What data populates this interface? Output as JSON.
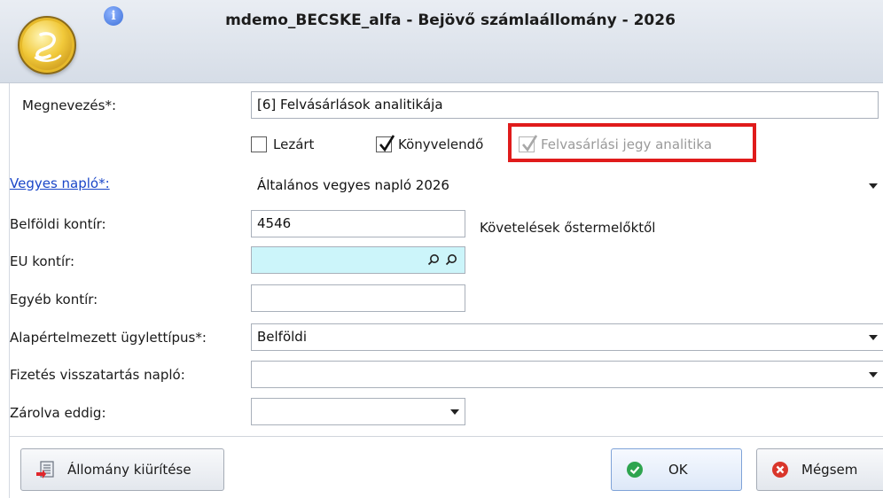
{
  "window": {
    "title": "mdemo_BECSKE_alfa - Bejövő számlaállomány - 2026"
  },
  "form": {
    "megnevezes": {
      "label": "Megnevezés*:",
      "value": "[6] Felvásárlások analitikája"
    },
    "checkboxes": {
      "lezart": {
        "label": "Lezárt",
        "checked": false
      },
      "konyvelendo": {
        "label": "Könyvelendő",
        "checked": true
      },
      "felvasarlasi": {
        "label": "Felvasárlási jegy analitika",
        "checked": true,
        "disabled": true
      }
    },
    "vegyes_naplo": {
      "label": "Vegyes napló*:",
      "value": "Általános vegyes napló 2026"
    },
    "belfoldi_kontir": {
      "label": "Belföldi kontír:",
      "value": "4546",
      "description": "Követelések őstermelőktől"
    },
    "eu_kontir": {
      "label": "EU kontír:",
      "value": ""
    },
    "egyeb_kontir": {
      "label": "Egyéb kontír:",
      "value": ""
    },
    "ugylettipus": {
      "label": "Alapértelmezett ügylettípus*:",
      "value": "Belföldi"
    },
    "fizetes_naplo": {
      "label": "Fizetés visszatartás napló:",
      "value": ""
    },
    "zarolva": {
      "label": "Zárolva eddig:",
      "value": ""
    }
  },
  "buttons": {
    "kiurites": "Állomány kiürítése",
    "ok": "OK",
    "megsem": "Mégsem"
  },
  "colors": {
    "highlight_frame": "#e01b1b",
    "link": "#1a46c8",
    "lookup_field": "#ccf5fa"
  }
}
